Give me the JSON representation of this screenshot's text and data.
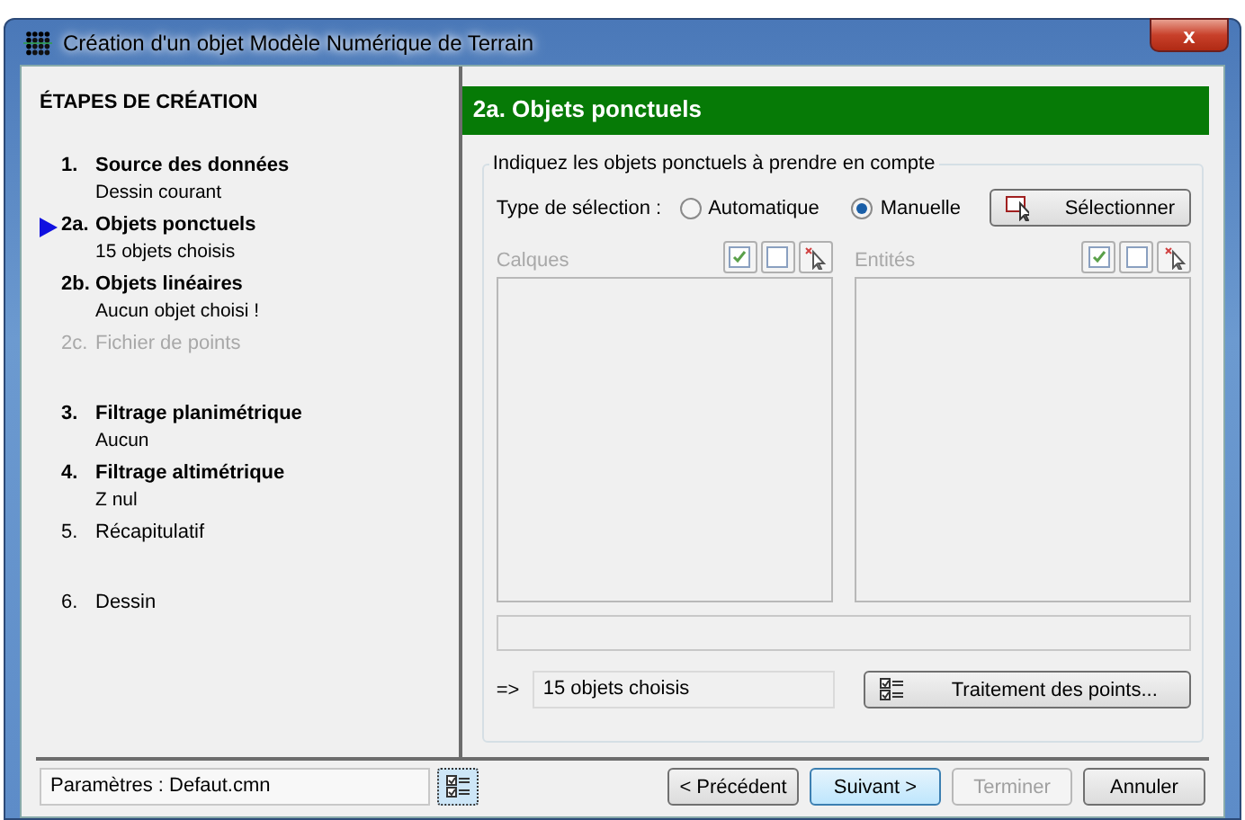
{
  "window": {
    "title": "Création d'un objet Modèle Numérique de Terrain",
    "close": "x"
  },
  "sidebar": {
    "heading": "ÉTAPES DE CRÉATION",
    "groups": [
      {
        "steps": [
          {
            "number": "1.",
            "title": "Source des données",
            "subtitle": "Dessin courant",
            "kind": "main",
            "selected": false,
            "disabled": false
          },
          {
            "number": "2a.",
            "title": "Objets ponctuels",
            "subtitle": "15 objets choisis",
            "kind": "main",
            "selected": true,
            "disabled": false
          },
          {
            "number": "2b.",
            "title": "Objets linéaires",
            "subtitle": "Aucun objet choisi !",
            "kind": "main",
            "selected": false,
            "disabled": false
          },
          {
            "number": "2c.",
            "title": "Fichier de points",
            "kind": "plain",
            "selected": false,
            "disabled": true
          }
        ]
      },
      {
        "steps": [
          {
            "number": "3.",
            "title": "Filtrage planimétrique",
            "subtitle": "Aucun",
            "kind": "main",
            "selected": false,
            "disabled": false
          },
          {
            "number": "4.",
            "title": "Filtrage altimétrique",
            "subtitle": "Z nul",
            "kind": "main",
            "selected": false,
            "disabled": false
          },
          {
            "number": "5.",
            "title": "Récapitulatif",
            "kind": "plain",
            "selected": false,
            "disabled": false
          }
        ]
      },
      {
        "steps": [
          {
            "number": "6.",
            "title": "Dessin",
            "kind": "plain",
            "selected": false,
            "disabled": false
          }
        ]
      }
    ]
  },
  "panel": {
    "header": "2a. Objets ponctuels",
    "group_label": "Indiquez les objets ponctuels à prendre en compte",
    "selection_label": "Type de sélection :",
    "radios": [
      {
        "label": "Automatique",
        "selected": false
      },
      {
        "label": "Manuelle",
        "selected": true
      }
    ],
    "select_button": "Sélectionner",
    "lists": [
      {
        "label": "Calques",
        "disabled": true
      },
      {
        "label": "Entités",
        "disabled": true
      }
    ],
    "result_prefix": "=>",
    "result": "15 objets choisis",
    "process_button": "Traitement des points..."
  },
  "footer": {
    "params": "Paramètres : Defaut.cmn",
    "buttons": [
      {
        "label": "< Précédent",
        "kind": "normal"
      },
      {
        "label": "Suivant >",
        "kind": "default"
      },
      {
        "label": "Terminer",
        "kind": "disabled"
      },
      {
        "label": "Annuler",
        "kind": "normal"
      }
    ]
  }
}
